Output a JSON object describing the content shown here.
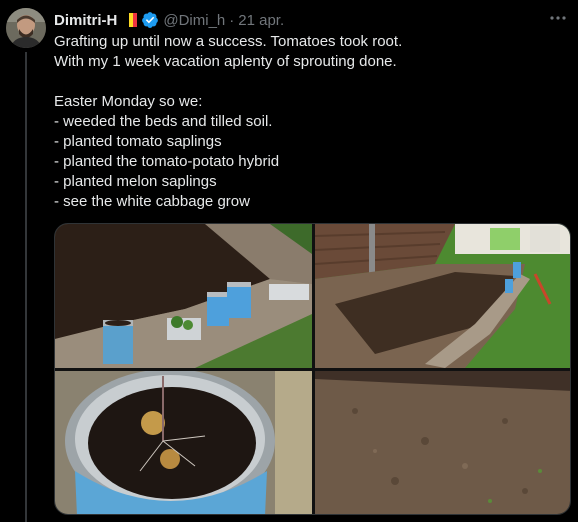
{
  "author": {
    "name": "Dimitri-H",
    "handle": "@Dimi_h",
    "separator": "·",
    "date": "21 apr.",
    "flag_colors": [
      "#000000",
      "#fdda24",
      "#ef3340"
    ]
  },
  "tweet_text": [
    "Grafting up until now a success. Tomatoes took root.",
    "With my 1 week vacation aplenty of sprouting done.",
    "",
    "Easter Monday so we:",
    "- weeded the beds and tilled soil.",
    "- planted tomato saplings",
    "- planted the tomato-potato hybrid",
    "- planted melon saplings",
    "- see the white cabbage grow"
  ],
  "colors": {
    "background": "#000000",
    "text": "#e7e9ea",
    "muted": "#71767b",
    "verified": "#1d9bf0",
    "border": "#2f3336"
  },
  "icons": {
    "verified": "verified-badge-icon",
    "more": "more-options-icon"
  },
  "media": [
    {
      "name": "photo-garden-bed-with-cans"
    },
    {
      "name": "photo-garden-plots-fence"
    },
    {
      "name": "photo-tin-can-soil"
    },
    {
      "name": "photo-tilled-soil"
    }
  ]
}
